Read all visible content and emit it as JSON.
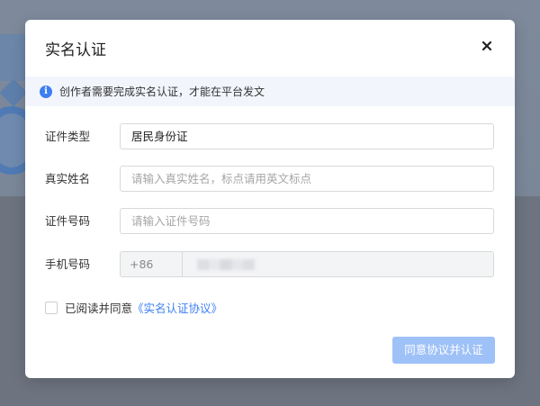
{
  "modal": {
    "title": "实名认证",
    "notice": "创作者需要完成实名认证，才能在平台发文",
    "fields": {
      "id_type": {
        "label": "证件类型",
        "value": "居民身份证"
      },
      "real_name": {
        "label": "真实姓名",
        "placeholder": "请输入真实姓名，标点请用英文标点"
      },
      "id_number": {
        "label": "证件号码",
        "placeholder": "请输入证件号码"
      },
      "phone": {
        "label": "手机号码",
        "prefix": "+86"
      }
    },
    "agreement": {
      "text": "已阅读并同意",
      "link": "《实名认证协议》"
    },
    "submit_label": "同意协议并认证"
  },
  "icons": {
    "close": "close-icon",
    "info": "info-icon"
  },
  "colors": {
    "accent": "#3d7ef5",
    "button_disabled": "#9ec1f7",
    "notice_bg": "#f2f6fc"
  }
}
